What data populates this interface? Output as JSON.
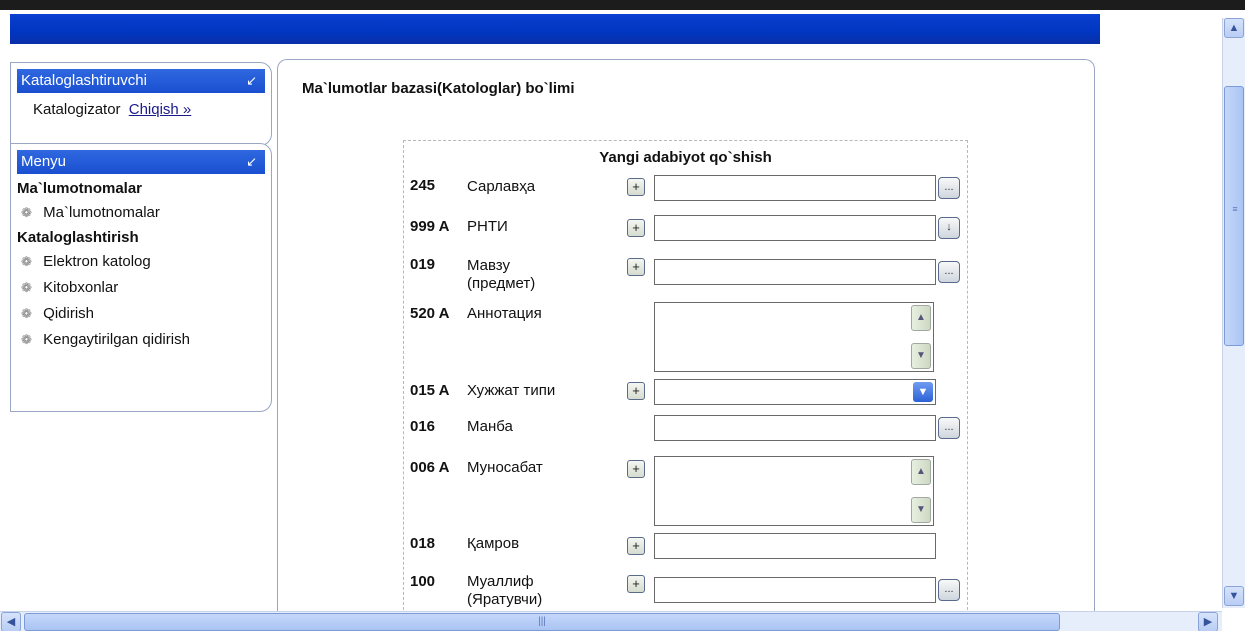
{
  "sidebar": {
    "panel1": {
      "title": "Kataloglashtiruvchi",
      "user": "Katalogizator",
      "logout": "Chiqish »"
    },
    "panel2": {
      "title": "Menyu",
      "sections": [
        {
          "heading": "Ma`lumotnomalar",
          "items": [
            "Ma`lumotnomalar"
          ]
        },
        {
          "heading": "Kataloglashtirish",
          "items": [
            "Elektron katolog",
            "Kitobxonlar",
            "Qidirish",
            "Kengaytirilgan qidirish"
          ]
        }
      ]
    }
  },
  "main": {
    "title": "Ma`lumotlar bazasi(Katologlar) bo`limi",
    "form_title": "Yangi adabiyot qo`shish",
    "fields": [
      {
        "code": "245",
        "label": "Сарлавҳа"
      },
      {
        "code": "999 A",
        "label": "РНТИ"
      },
      {
        "code": "019",
        "label": "Мавзу (предмет)"
      },
      {
        "code": "520 A",
        "label": "Аннотация"
      },
      {
        "code": "015 A",
        "label": "Хужжат типи"
      },
      {
        "code": "016",
        "label": "Манба"
      },
      {
        "code": "006 A",
        "label": "Муносабат"
      },
      {
        "code": "018",
        "label": "Қамров"
      },
      {
        "code": "100",
        "label": "Муаллиф (Яратувчи)"
      }
    ]
  },
  "icons": {
    "collapse": "collapse-arrow-icon",
    "menu_item": "books-icon",
    "plus": "+",
    "ellipsis": "...",
    "down_arrow": "↓"
  },
  "colors": {
    "header_blue": "#0036c0",
    "panel_head": "#2f68e0"
  }
}
